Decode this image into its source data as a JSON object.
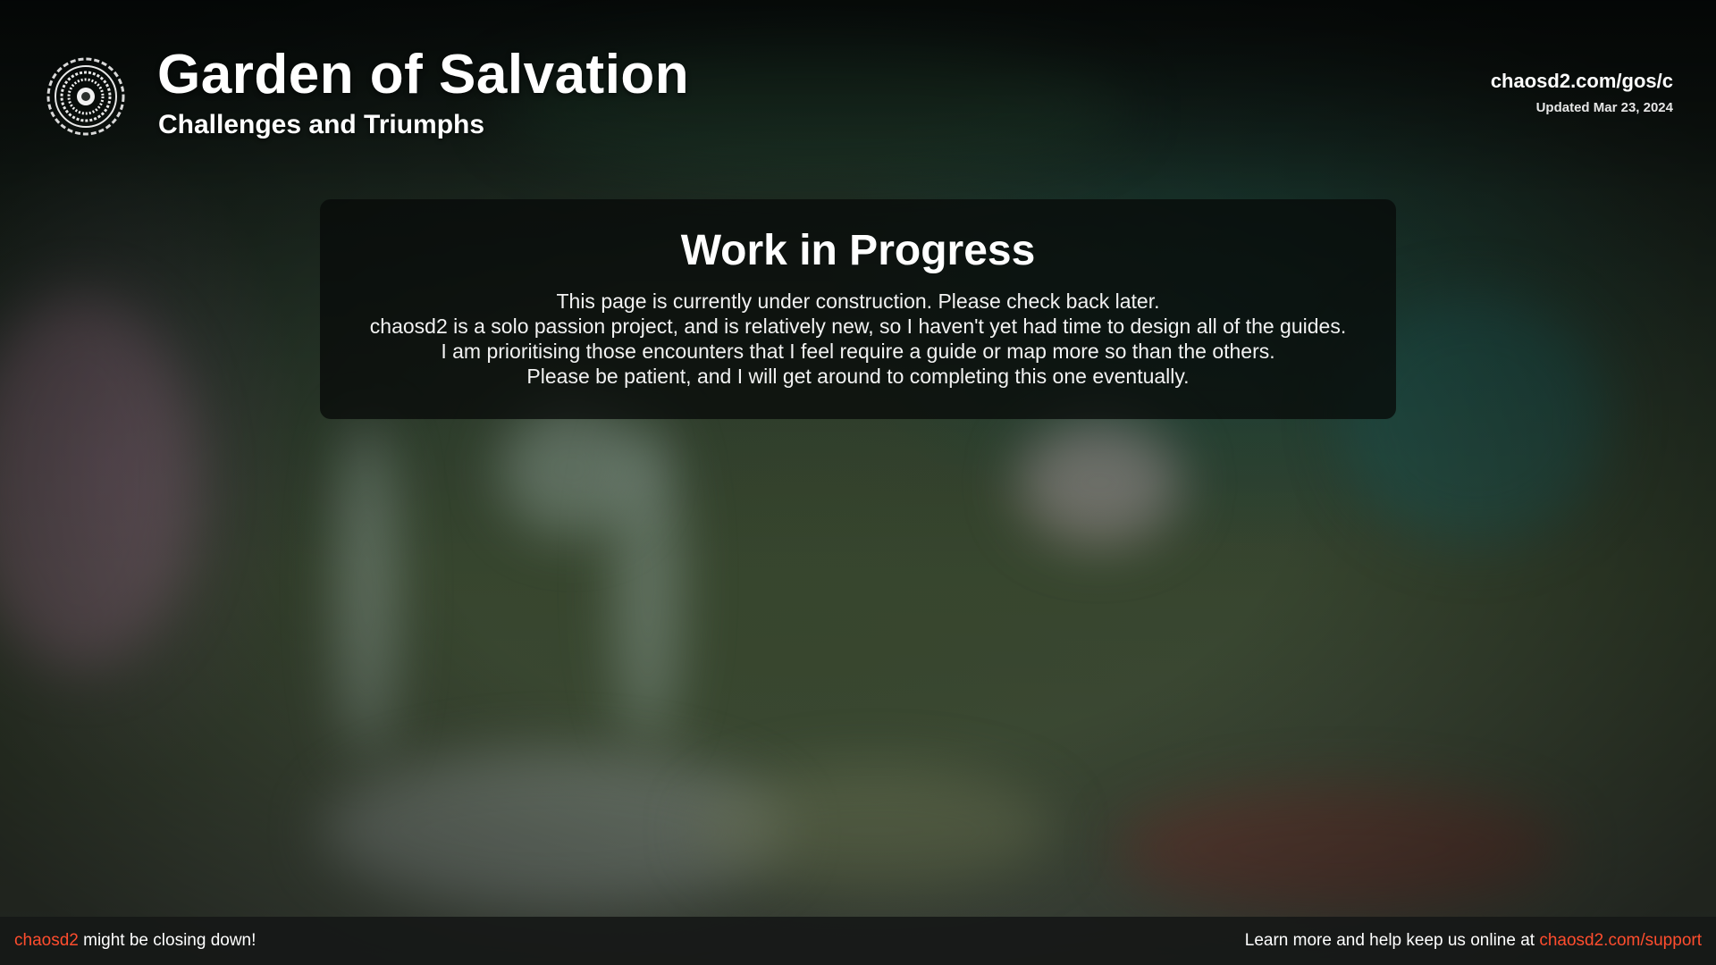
{
  "header": {
    "title": "Garden of Salvation",
    "subtitle": "Challenges and Triumphs",
    "site_link": "chaosd2.com/gos/c",
    "updated": "Updated Mar 23, 2024",
    "logo_icon": "garden-of-salvation-emblem-icon"
  },
  "panel": {
    "title": "Work in Progress",
    "lines": [
      "This page is currently under construction. Please check back later.",
      "chaosd2 is a solo passion project, and is relatively new, so I haven't yet had time to design all of the guides.",
      "I am prioritising those encounters that I feel require a guide or map more so than the others.",
      "Please be patient, and I will get around to completing this one eventually."
    ]
  },
  "footer": {
    "left_link": "chaosd2",
    "left_text": " might be closing down!",
    "right_text": "Learn more and help keep us online at ",
    "right_link": "chaosd2.com/support"
  },
  "colors": {
    "accent": "#ff4d2e",
    "panel_bg": "#080a09",
    "footer_bg": "#161817"
  }
}
